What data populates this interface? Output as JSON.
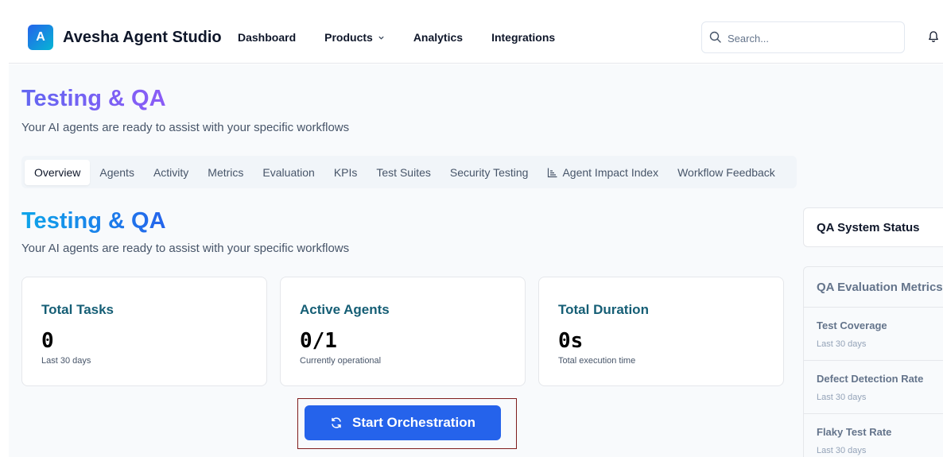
{
  "header": {
    "logo_letter": "A",
    "brand": "Avesha Agent Studio",
    "nav": [
      "Dashboard",
      "Products",
      "Analytics",
      "Integrations"
    ],
    "search_placeholder": "Search..."
  },
  "page": {
    "title": "Testing & QA",
    "subtitle": "Your AI agents are ready to assist with your specific workflows"
  },
  "tabs": [
    "Overview",
    "Agents",
    "Activity",
    "Metrics",
    "Evaluation",
    "KPIs",
    "Test Suites",
    "Security Testing",
    "Agent Impact Index",
    "Workflow Feedback"
  ],
  "section": {
    "title": "Testing & QA",
    "subtitle": "Your AI agents are ready to assist with your specific workflows"
  },
  "cards": [
    {
      "title": "Total Tasks",
      "value": "0",
      "caption": "Last 30 days"
    },
    {
      "title": "Active Agents",
      "value": "0/1",
      "caption": "Currently operational"
    },
    {
      "title": "Total Duration",
      "value": "0s",
      "caption": "Total execution time"
    }
  ],
  "start_button": "Start Orchestration",
  "side": {
    "status_title": "QA System Status",
    "metrics_title": "QA Evaluation Metrics",
    "metrics": [
      {
        "name": "Test Coverage",
        "period": "Last 30 days"
      },
      {
        "name": "Defect Detection Rate",
        "period": "Last 30 days"
      },
      {
        "name": "Flaky Test Rate",
        "period": "Last 30 days"
      }
    ]
  },
  "colors": {
    "primary": "#2563eb",
    "title_purple": "#6366f1",
    "title_blue": "#0ea5e9",
    "card_title": "#155e75"
  }
}
